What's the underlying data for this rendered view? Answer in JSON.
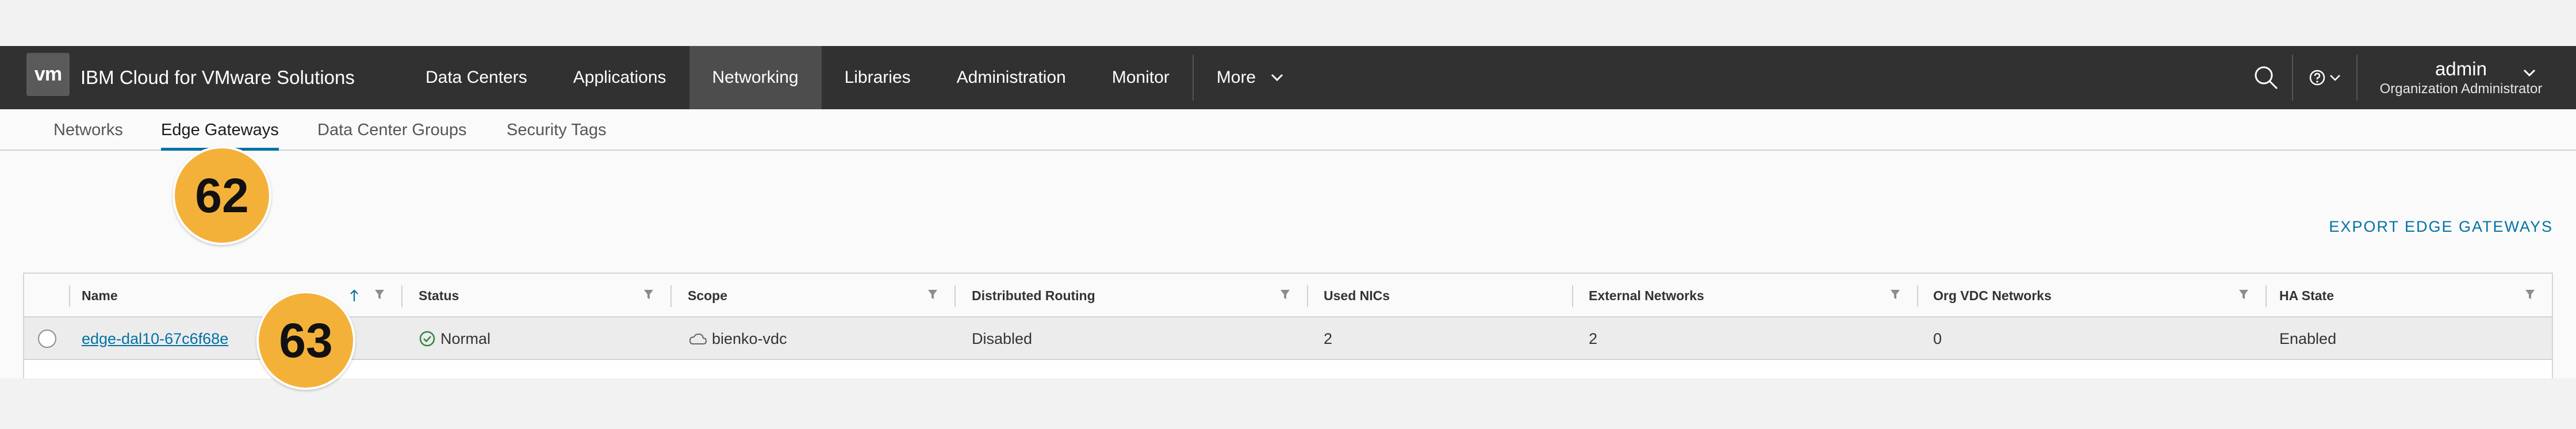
{
  "header": {
    "logo_text": "vm",
    "app_title": "IBM Cloud for VMware Solutions",
    "nav": [
      {
        "label": "Data Centers",
        "active": false
      },
      {
        "label": "Applications",
        "active": false
      },
      {
        "label": "Networking",
        "active": true
      },
      {
        "label": "Libraries",
        "active": false
      },
      {
        "label": "Administration",
        "active": false
      },
      {
        "label": "Monitor",
        "active": false
      }
    ],
    "more_label": "More",
    "user_name": "admin",
    "user_role": "Organization Administrator"
  },
  "subnav": {
    "tabs": [
      {
        "label": "Networks",
        "active": false
      },
      {
        "label": "Edge Gateways",
        "active": true
      },
      {
        "label": "Data Center Groups",
        "active": false
      },
      {
        "label": "Security Tags",
        "active": false
      }
    ]
  },
  "content": {
    "export_label": "EXPORT EDGE GATEWAYS"
  },
  "grid": {
    "columns": [
      "Name",
      "Status",
      "Scope",
      "Distributed Routing",
      "Used NICs",
      "External Networks",
      "Org VDC Networks",
      "HA State"
    ],
    "rows": [
      {
        "name": "edge-dal10-67c6f68e",
        "status": "Normal",
        "scope": "bienko-vdc",
        "distributed_routing": "Disabled",
        "used_nics": "2",
        "external_networks": "2",
        "org_vdc_networks": "0",
        "ha_state": "Enabled"
      }
    ]
  },
  "callouts": {
    "first": "62",
    "second": "63"
  },
  "colors": {
    "header_bg": "#313131",
    "accent": "#0072a3",
    "callout": "#f4b13a",
    "status_ok": "#2e8540"
  }
}
